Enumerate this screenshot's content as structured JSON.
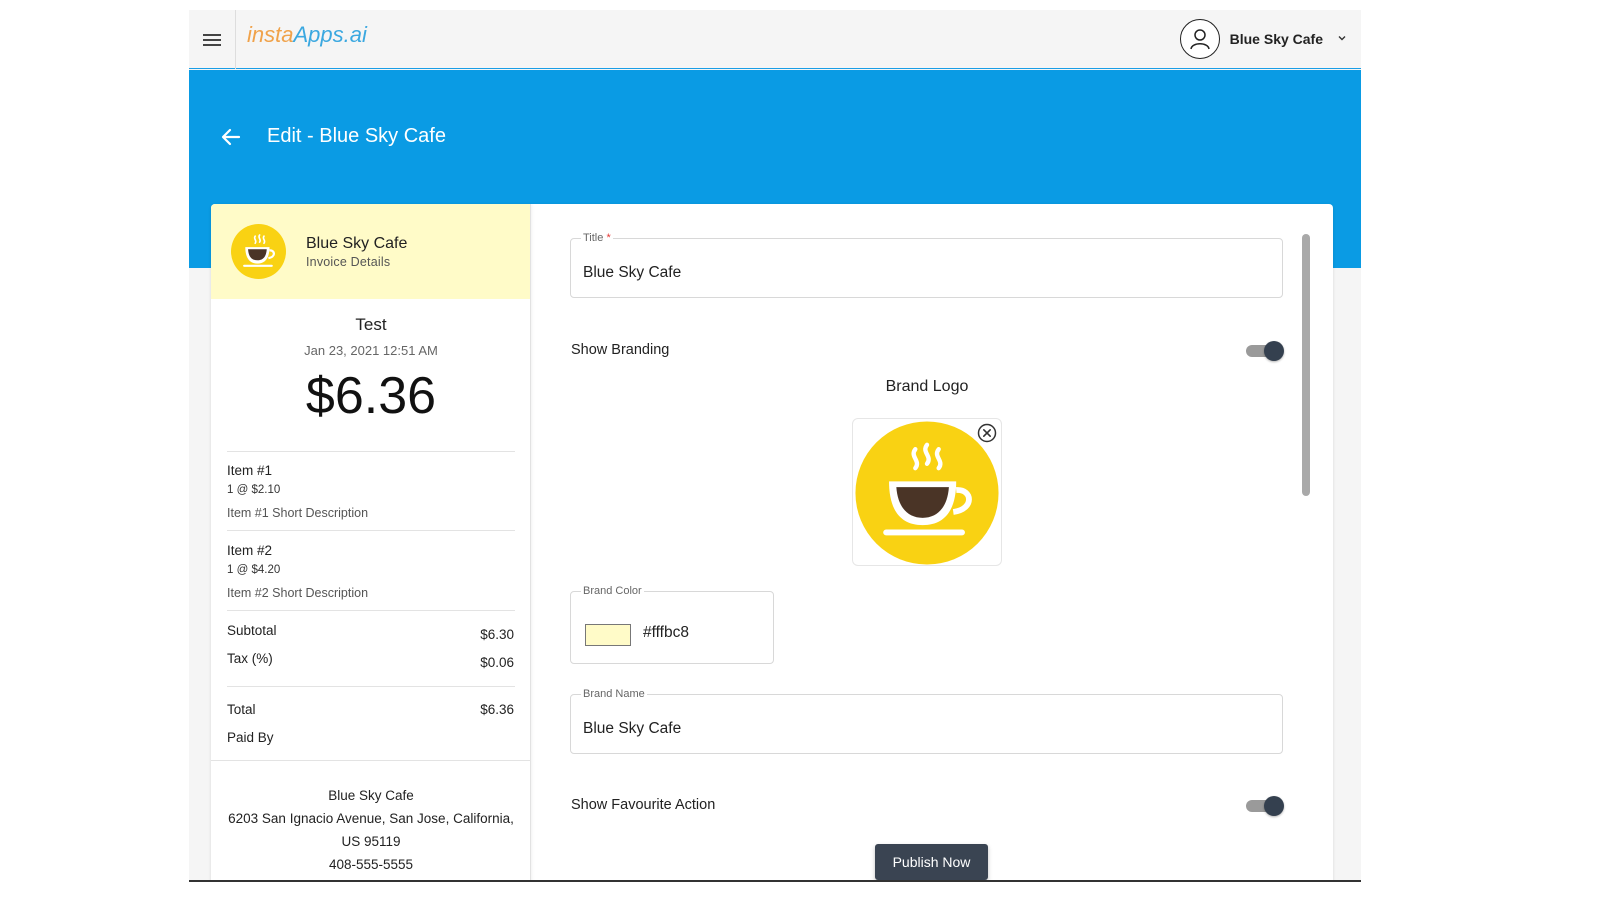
{
  "header": {
    "logo_prefix": "insta",
    "logo_suffix": "Apps.ai",
    "user_name": "Blue Sky Cafe"
  },
  "page": {
    "title": "Edit - Blue Sky Cafe"
  },
  "preview": {
    "brand_name": "Blue Sky Cafe",
    "subtitle": "Invoice Details",
    "invoice_name": "Test",
    "date": "Jan 23, 2021 12:51 AM",
    "amount": "$6.36",
    "items": [
      {
        "name": "Item #1",
        "qty": "1 @ $2.10",
        "description": "Item #1 Short Description"
      },
      {
        "name": "Item #2",
        "qty": "1 @ $4.20",
        "description": "Item #2 Short Description"
      }
    ],
    "subtotal_label": "Subtotal",
    "subtotal_value": "$6.30",
    "tax_label": "Tax (%)",
    "tax_value": "$0.06",
    "total_label": "Total",
    "total_value": "$6.36",
    "paid_by_label": "Paid By",
    "footer": {
      "name": "Blue Sky Cafe",
      "address_line1": "6203 San Ignacio Avenue, San Jose, California,",
      "address_line2": "US 95119",
      "phone": "408-555-5555"
    }
  },
  "form": {
    "title_label": "Title",
    "title_required_mark": "*",
    "title_value": "Blue Sky Cafe",
    "show_branding_label": "Show Branding",
    "show_branding_on": true,
    "brand_logo_label": "Brand Logo",
    "brand_color_label": "Brand Color",
    "brand_color_value": "#fffbc8",
    "brand_name_label": "Brand Name",
    "brand_name_value": "Blue Sky Cafe",
    "show_favourite_label": "Show Favourite Action",
    "show_favourite_on": true,
    "publish_label": "Publish Now"
  },
  "colors": {
    "accent_blue": "#0a9be4",
    "brand_yellow": "#fffbc8",
    "logo_yellow": "#f9d213",
    "button_dark": "#3a4452"
  },
  "icons": {
    "menu": "hamburger-icon",
    "avatar": "user-circle-icon",
    "chevron": "chevron-down-icon",
    "back": "arrow-left-icon",
    "logo": "coffee-cup-icon",
    "remove": "close-circle-icon"
  }
}
